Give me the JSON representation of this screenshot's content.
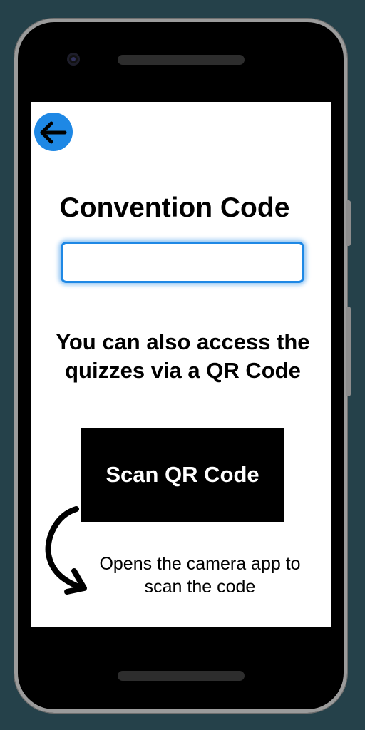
{
  "screen": {
    "title": "Convention Code",
    "code_input": {
      "value": "",
      "placeholder": ""
    },
    "info_lines": [
      "You can also access the",
      "quizzes via a QR Code"
    ],
    "scan_button_label": "Scan QR Code",
    "note_lines": [
      "Opens the camera app to",
      "scan the code"
    ]
  },
  "icons": {
    "back": "arrow-left-icon",
    "annotation": "curved-arrow-sketch"
  },
  "colors": {
    "background": "#25414a",
    "accent": "#1e88e5",
    "button": "#000000",
    "button_text": "#ffffff"
  }
}
